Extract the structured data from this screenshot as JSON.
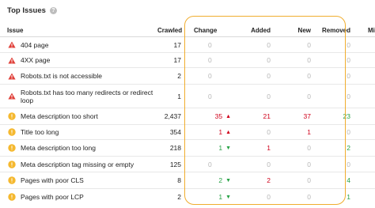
{
  "header": {
    "title": "Top Issues",
    "help_icon": "question-circle-icon"
  },
  "columns": {
    "issue": "Issue",
    "crawled": "Crawled",
    "change": "Change",
    "added": "Added",
    "new": "New",
    "removed": "Removed",
    "missing": "Missing"
  },
  "colors": {
    "error": "#e0403a",
    "warning": "#f5b82e",
    "highlight": "#f0ad2e",
    "increase": "#d0021b",
    "decrease": "#27a245"
  },
  "rows": [
    {
      "icon": "error-triangle-icon",
      "issue": "404 page",
      "crawled": "17",
      "change": "0",
      "added": "0",
      "new": "0",
      "removed": "0"
    },
    {
      "icon": "error-triangle-icon",
      "issue": "4XX page",
      "crawled": "17",
      "change": "0",
      "added": "0",
      "new": "0",
      "removed": "0"
    },
    {
      "icon": "error-triangle-icon",
      "issue": "Robots.txt is not accessible",
      "crawled": "2",
      "change": "0",
      "added": "0",
      "new": "0",
      "removed": "0"
    },
    {
      "icon": "error-triangle-icon",
      "issue": "Robots.txt has too many redirects or redirect loop",
      "crawled": "1",
      "change": "0",
      "added": "0",
      "new": "0",
      "removed": "0"
    },
    {
      "icon": "warning-circle-icon",
      "issue": "Meta description too short",
      "crawled": "2,437",
      "change": "35",
      "change_dir": "up",
      "added": "21",
      "new": "37",
      "removed": "23"
    },
    {
      "icon": "warning-circle-icon",
      "issue": "Title too long",
      "crawled": "354",
      "change": "1",
      "change_dir": "up",
      "added": "0",
      "new": "1",
      "removed": "0"
    },
    {
      "icon": "warning-circle-icon",
      "issue": "Meta description too long",
      "crawled": "218",
      "change": "1",
      "change_dir": "down",
      "added": "1",
      "new": "0",
      "removed": "2"
    },
    {
      "icon": "warning-circle-icon",
      "issue": "Meta description tag missing or empty",
      "crawled": "125",
      "change": "0",
      "added": "0",
      "new": "0",
      "removed": "0"
    },
    {
      "icon": "warning-circle-icon",
      "issue": "Pages with poor CLS",
      "crawled": "8",
      "change": "2",
      "change_dir": "down",
      "added": "2",
      "new": "0",
      "removed": "4"
    },
    {
      "icon": "warning-circle-icon",
      "issue": "Pages with poor LCP",
      "crawled": "2",
      "change": "1",
      "change_dir": "down",
      "added": "0",
      "new": "0",
      "removed": "1"
    }
  ]
}
